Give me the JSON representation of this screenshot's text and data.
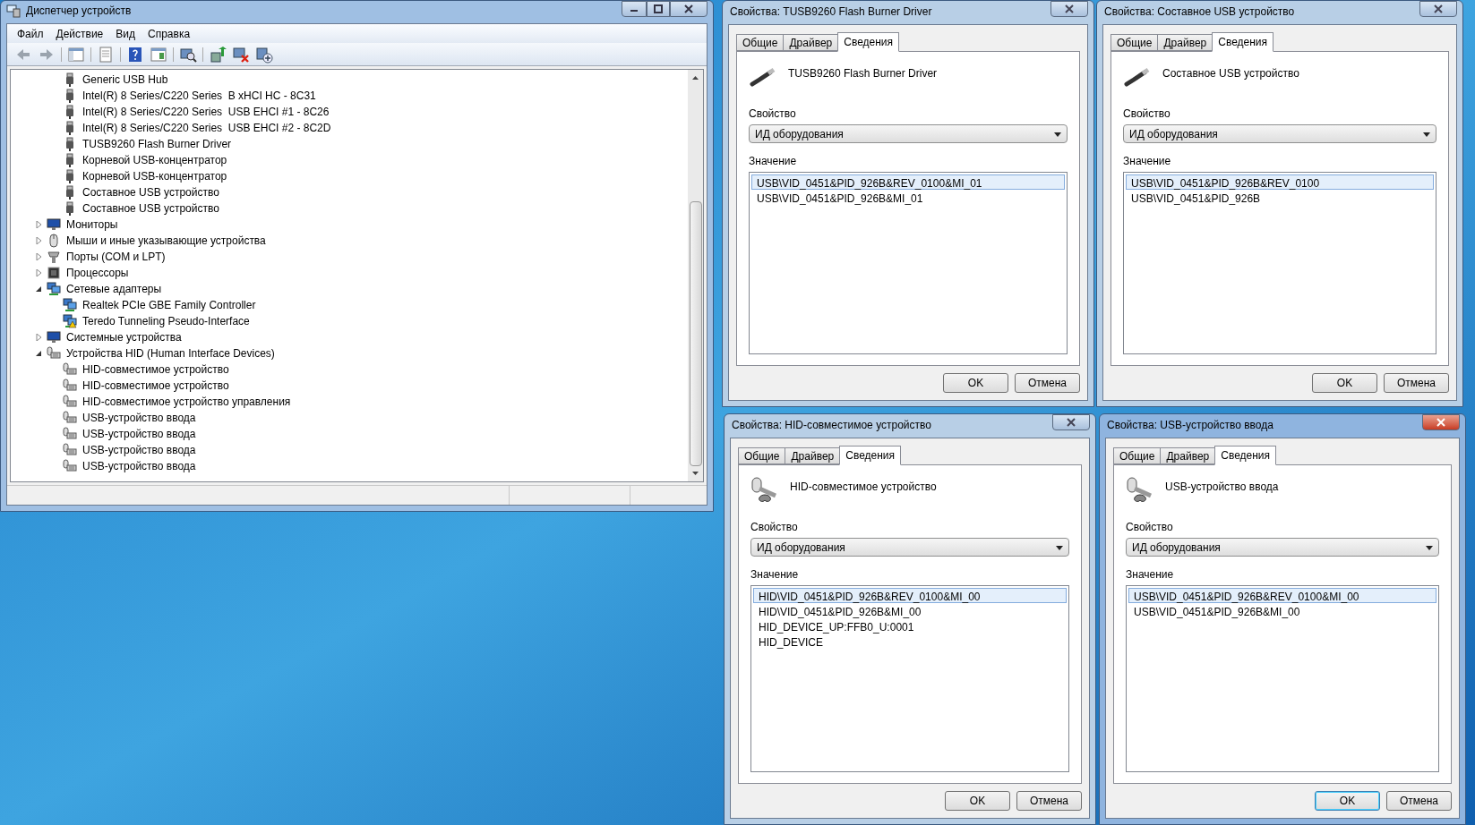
{
  "device_manager": {
    "title": "Диспетчер устройств",
    "menu": [
      "Файл",
      "Действие",
      "Вид",
      "Справка"
    ],
    "scrolled_group": [
      {
        "label": "Generic USB Hub",
        "kind": "usb"
      },
      {
        "label": "Intel(R) 8 Series/C220 Series  B xHCI HC - 8C31",
        "kind": "usb"
      },
      {
        "label": "Intel(R) 8 Series/C220 Series  USB EHCI #1 - 8C26",
        "kind": "usb"
      },
      {
        "label": "Intel(R) 8 Series/C220 Series  USB EHCI #2 - 8C2D",
        "kind": "usb"
      },
      {
        "label": "TUSB9260 Flash Burner Driver",
        "kind": "usb"
      },
      {
        "label": "Корневой USB-концентратор",
        "kind": "usb"
      },
      {
        "label": "Корневой USB-концентратор",
        "kind": "usb"
      },
      {
        "label": "Составное USB устройство",
        "kind": "usb"
      },
      {
        "label": "Составное USB устройство",
        "kind": "usb"
      }
    ],
    "categories": [
      {
        "label": "Мониторы",
        "kind": "monitor",
        "expanded": false
      },
      {
        "label": "Мыши и иные указывающие устройства",
        "kind": "mouse",
        "expanded": false
      },
      {
        "label": "Порты (COM и LPT)",
        "kind": "port",
        "expanded": false
      },
      {
        "label": "Процессоры",
        "kind": "cpu",
        "expanded": false
      },
      {
        "label": "Сетевые адаптеры",
        "kind": "network",
        "expanded": true,
        "children": [
          {
            "label": "Realtek PCIe GBE Family Controller",
            "kind": "network"
          },
          {
            "label": "Teredo Tunneling Pseudo-Interface",
            "kind": "network-warning"
          }
        ]
      },
      {
        "label": "Системные устройства",
        "kind": "monitor",
        "expanded": false
      },
      {
        "label": "Устройства HID (Human Interface Devices)",
        "kind": "hid",
        "expanded": true,
        "children": [
          {
            "label": "HID-совместимое устройство",
            "kind": "hid"
          },
          {
            "label": "HID-совместимое устройство",
            "kind": "hid"
          },
          {
            "label": "HID-совместимое устройство управления",
            "kind": "hid"
          },
          {
            "label": "USB-устройство ввода",
            "kind": "hid"
          },
          {
            "label": "USB-устройство ввода",
            "kind": "hid"
          },
          {
            "label": "USB-устройство ввода",
            "kind": "hid"
          },
          {
            "label": "USB-устройство ввода",
            "kind": "hid"
          }
        ]
      }
    ]
  },
  "dialogs": [
    {
      "title": "Свойства: TUSB9260 Flash Burner Driver",
      "active": false,
      "kind": "usb",
      "device_name": "TUSB9260 Flash Burner Driver",
      "tabs": [
        {
          "label": "Общие",
          "selected": false
        },
        {
          "label": "Драйвер",
          "selected": false
        },
        {
          "label": "Сведения",
          "selected": true
        }
      ],
      "property_label": "Свойство",
      "property_value": "ИД оборудования",
      "value_label": "Значение",
      "values": [
        {
          "text": "USB\\VID_0451&PID_926B&REV_0100&MI_01",
          "selected": true
        },
        {
          "text": "USB\\VID_0451&PID_926B&MI_01",
          "selected": false
        }
      ],
      "buttons": [
        {
          "label": "OK",
          "default": false
        },
        {
          "label": "Отмена",
          "default": false
        }
      ]
    },
    {
      "title": "Свойства: Составное USB устройство",
      "active": false,
      "kind": "usb",
      "device_name": "Составное USB устройство",
      "tabs": [
        {
          "label": "Общие",
          "selected": false
        },
        {
          "label": "Драйвер",
          "selected": false
        },
        {
          "label": "Сведения",
          "selected": true
        }
      ],
      "property_label": "Свойство",
      "property_value": "ИД оборудования",
      "value_label": "Значение",
      "values": [
        {
          "text": "USB\\VID_0451&PID_926B&REV_0100",
          "selected": true
        },
        {
          "text": "USB\\VID_0451&PID_926B",
          "selected": false
        }
      ],
      "buttons": [
        {
          "label": "OK",
          "default": false
        },
        {
          "label": "Отмена",
          "default": false
        }
      ]
    },
    {
      "title": "Свойства: HID-совместимое устройство",
      "active": false,
      "kind": "hid",
      "device_name": "HID-совместимое устройство",
      "tabs": [
        {
          "label": "Общие",
          "selected": false
        },
        {
          "label": "Драйвер",
          "selected": false
        },
        {
          "label": "Сведения",
          "selected": true
        }
      ],
      "property_label": "Свойство",
      "property_value": "ИД оборудования",
      "value_label": "Значение",
      "values": [
        {
          "text": "HID\\VID_0451&PID_926B&REV_0100&MI_00",
          "selected": true
        },
        {
          "text": "HID\\VID_0451&PID_926B&MI_00",
          "selected": false
        },
        {
          "text": "HID_DEVICE_UP:FFB0_U:0001",
          "selected": false
        },
        {
          "text": "HID_DEVICE",
          "selected": false
        }
      ],
      "buttons": [
        {
          "label": "OK",
          "default": false
        },
        {
          "label": "Отмена",
          "default": false
        }
      ]
    },
    {
      "title": "Свойства: USB-устройство ввода",
      "active": true,
      "kind": "hid",
      "device_name": "USB-устройство ввода",
      "tabs": [
        {
          "label": "Общие",
          "selected": false
        },
        {
          "label": "Драйвер",
          "selected": false
        },
        {
          "label": "Сведения",
          "selected": true
        }
      ],
      "property_label": "Свойство",
      "property_value": "ИД оборудования",
      "value_label": "Значение",
      "values": [
        {
          "text": "USB\\VID_0451&PID_926B&REV_0100&MI_00",
          "selected": true
        },
        {
          "text": "USB\\VID_0451&PID_926B&MI_00",
          "selected": false
        }
      ],
      "buttons": [
        {
          "label": "OK",
          "default": true
        },
        {
          "label": "Отмена",
          "default": false
        }
      ]
    }
  ]
}
